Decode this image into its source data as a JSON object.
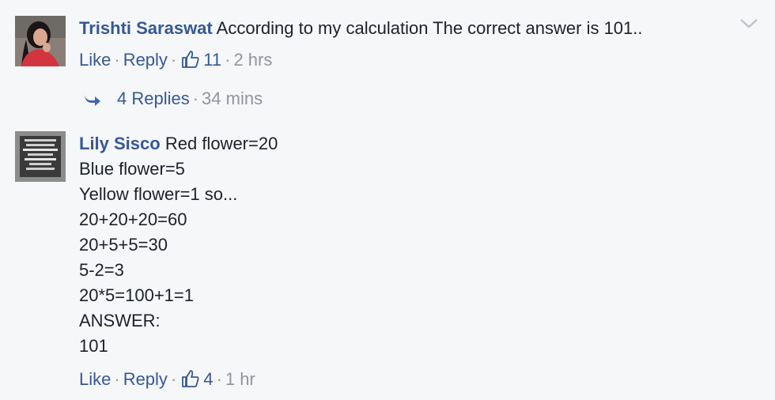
{
  "comments": [
    {
      "author": "Trishti Saraswat",
      "text": "According to my calculation The correct answer is 101..",
      "actions": {
        "like_label": "Like",
        "reply_label": "Reply",
        "like_count": "11",
        "time": "2 hrs"
      },
      "avatar_icon": "profile-photo-woman",
      "replies": {
        "label": "4 Replies",
        "time": "34 mins"
      }
    },
    {
      "author": "Lily Sisco",
      "first_line": "Red flower=20",
      "lines": [
        "Blue flower=5",
        "Yellow flower=1 so...",
        "20+20+20=60",
        "20+5+5=30",
        "5-2=3",
        "20*5=100+1=1",
        "ANSWER:",
        "101"
      ],
      "actions": {
        "like_label": "Like",
        "reply_label": "Reply",
        "like_count": "4",
        "time": "1 hr"
      },
      "avatar_icon": "profile-photo-text-poster"
    }
  ],
  "colors": {
    "author": "#365899",
    "meta": "#90949c",
    "text": "#1d2129",
    "background": "#f6f7f9"
  }
}
